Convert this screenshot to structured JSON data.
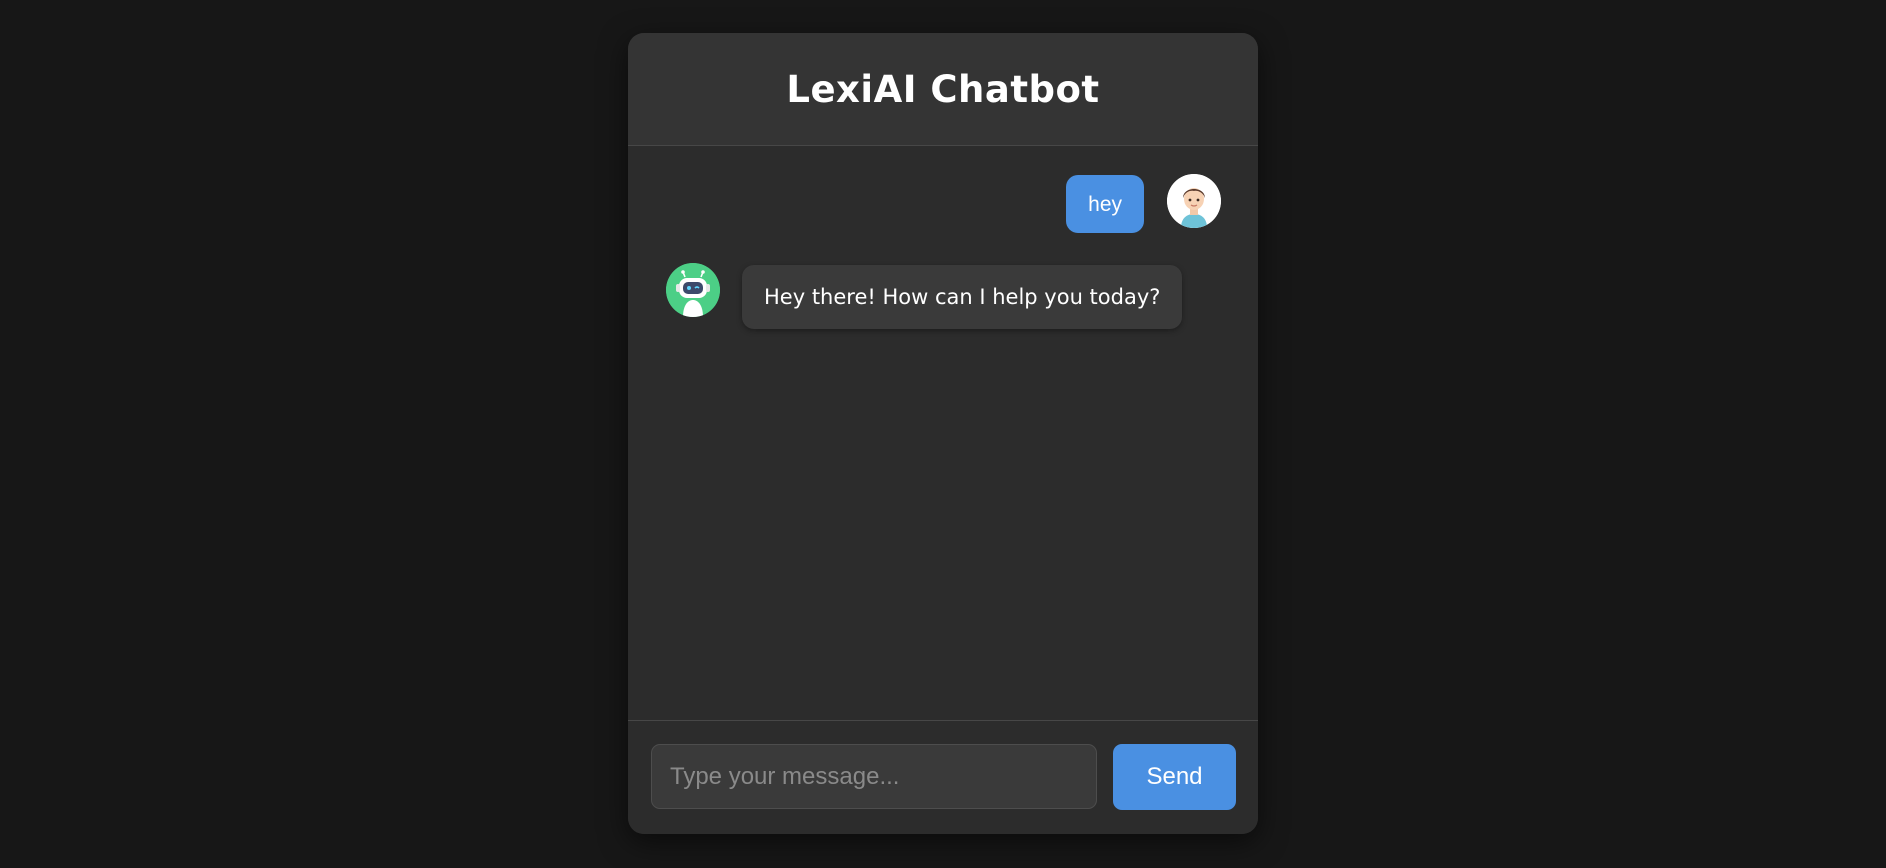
{
  "header": {
    "title": "LexiAI Chatbot"
  },
  "messages": [
    {
      "sender": "user",
      "text": "hey",
      "avatar_icon": "user-avatar-icon"
    },
    {
      "sender": "bot",
      "text": "Hey there! How can I help you today?",
      "avatar_icon": "robot-icon"
    }
  ],
  "composer": {
    "placeholder": "Type your message...",
    "value": "",
    "send_label": "Send"
  },
  "colors": {
    "page_background": "#171717",
    "panel_background": "#2c2c2c",
    "header_background": "#343434",
    "accent": "#4a90e2",
    "bot_bubble": "#3a3a3a",
    "bot_avatar": "#4ccf86"
  }
}
